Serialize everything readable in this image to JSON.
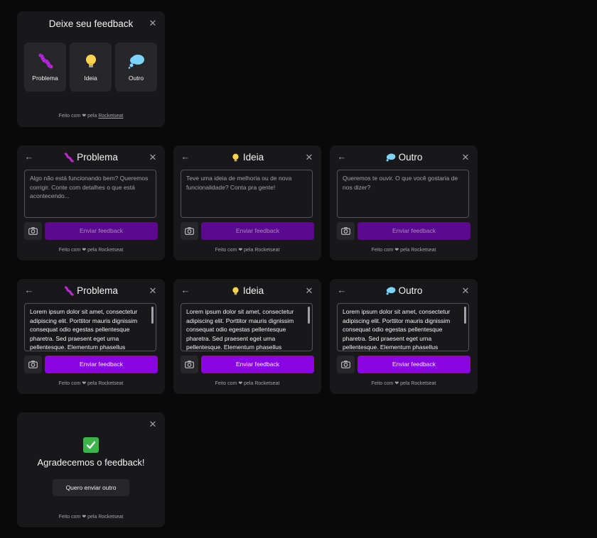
{
  "colors": {
    "background": "#09090a",
    "card": "#18181b",
    "brand": "#8a05e4",
    "brand_disabled": "#5b0a8f"
  },
  "icons": {
    "problem": "worm-icon",
    "idea": "light-bulb-icon",
    "other": "thought-cloud-icon",
    "success": "check-mark-icon",
    "screenshot": "camera-icon",
    "close": "close-icon",
    "back": "arrow-left-icon"
  },
  "footer": {
    "prefix": "Feito com",
    "middle": "pela",
    "brand": "Rocketseat"
  },
  "select_card": {
    "title": "Deixe seu feedback",
    "types": [
      {
        "label": "Problema"
      },
      {
        "label": "Ideia"
      },
      {
        "label": "Outro"
      }
    ]
  },
  "forms": [
    {
      "title": "Problema",
      "placeholder": "Algo não está funcionando bem? Queremos corrigir. Conte com detalhes o que está acontecendo...",
      "submit": "Enviar feedback"
    },
    {
      "title": "Ideia",
      "placeholder": "Teve uma ideia de melhoria ou de nova funcionalidade? Conta pra gente!",
      "submit": "Enviar feedback"
    },
    {
      "title": "Outro",
      "placeholder": "Queremos te ouvir. O que você gostaria de nos dizer?",
      "submit": "Enviar feedback"
    }
  ],
  "filled_forms": [
    {
      "title": "Problema",
      "value": "Lorem ipsum dolor sit amet, consectetur adipiscing elit. Porttitor mauris dignissim consequat odio egestas pellentesque pharetra. Sed praesent eget urna pellentesque. Elementum phasellus",
      "submit": "Enviar feedback"
    },
    {
      "title": "Ideia",
      "value": "Lorem ipsum dolor sit amet, consectetur adipiscing elit. Porttitor mauris dignissim consequat odio egestas pellentesque pharetra. Sed praesent eget urna pellentesque. Elementum phasellus",
      "submit": "Enviar feedback"
    },
    {
      "title": "Outro",
      "value": "Lorem ipsum dolor sit amet, consectetur adipiscing elit. Porttitor mauris dignissim consequat odio egestas pellentesque pharetra. Sed praesent eget urna pellentesque. Elementum phasellus",
      "submit": "Enviar feedback"
    }
  ],
  "success_card": {
    "title": "Agradecemos o feedback!",
    "button": "Quero enviar outro"
  }
}
